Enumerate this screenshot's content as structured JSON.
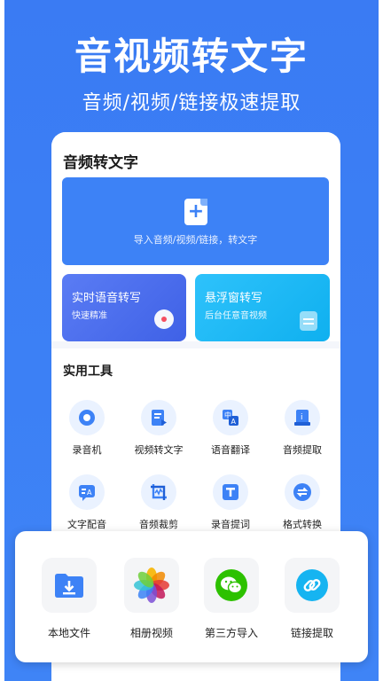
{
  "hero": {
    "title": "音视频转文字",
    "subtitle": "音频/视频/链接极速提取"
  },
  "main_card": {
    "title": "音频转文字",
    "import_label": "导入音频/视频/链接，转文字",
    "realtime": {
      "title": "实时语音转写",
      "subtitle": "快速精准"
    },
    "floating": {
      "title": "悬浮窗转写",
      "subtitle": "后台任意音视频"
    }
  },
  "tools": {
    "title": "实用工具",
    "items": [
      {
        "label": "录音机",
        "icon": "record-icon"
      },
      {
        "label": "视频转文字",
        "icon": "video-text-icon"
      },
      {
        "label": "语音翻译",
        "icon": "translate-icon"
      },
      {
        "label": "音频提取",
        "icon": "audio-extract-icon"
      },
      {
        "label": "文字配音",
        "icon": "text-dub-icon"
      },
      {
        "label": "音频裁剪",
        "icon": "audio-crop-icon"
      },
      {
        "label": "录音提词",
        "icon": "teleprompter-icon"
      },
      {
        "label": "格式转换",
        "icon": "format-convert-icon"
      }
    ]
  },
  "sources": {
    "items": [
      {
        "label": "本地文件",
        "icon": "folder-download-icon"
      },
      {
        "label": "相册视频",
        "icon": "photos-icon"
      },
      {
        "label": "第三方导入",
        "icon": "wechat-icon"
      },
      {
        "label": "链接提取",
        "icon": "link-icon"
      }
    ]
  },
  "colors": {
    "brand_blue": "#3d82f6",
    "cyan": "#16b4f1",
    "record_red": "#ff4d5a",
    "wechat_green": "#2dc100"
  }
}
